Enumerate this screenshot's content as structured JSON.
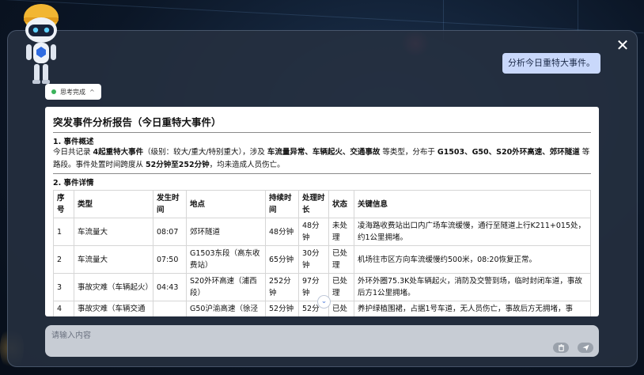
{
  "dialog": {
    "close_label": "✕"
  },
  "user_message": "分析今日重特大事件。",
  "thinking": {
    "label": "思考完成",
    "chevron": "^"
  },
  "report": {
    "title": "突发事件分析报告（今日重特大事件）",
    "section1": "1. 事件概述",
    "overview": [
      {
        "text": "今日共记录 ",
        "bold": false
      },
      {
        "text": "4起重特大事件",
        "bold": true
      },
      {
        "text": "（级别：较大/重大/特别重大），涉及 ",
        "bold": false
      },
      {
        "text": "车流量异常、车辆起火、交通事故",
        "bold": true
      },
      {
        "text": " 等类型，分布于 ",
        "bold": false
      },
      {
        "text": "G1503、G50、S20外环高速、郊环隧道",
        "bold": true
      },
      {
        "text": " 等路段。事件处置时间跨度从 ",
        "bold": false
      },
      {
        "text": "52分钟至252分钟",
        "bold": true
      },
      {
        "text": "，均未造成人员伤亡。",
        "bold": false
      }
    ],
    "section2": "2. 事件详情",
    "columns": [
      "序号",
      "类型",
      "发生时间",
      "地点",
      "持续时间",
      "处理时长",
      "状态",
      "关键信息"
    ],
    "rows": [
      [
        "1",
        "车流量大",
        "08:07",
        "郊环隧道",
        "48分钟",
        "48分钟",
        "未处理",
        "凌海路收费站出口内广场车流缓慢，通行至隧道上行K211+015处，约1公里拥堵。"
      ],
      [
        "2",
        "车流量大",
        "07:50",
        "G1503东段（高东收费站）",
        "65分钟",
        "30分钟",
        "已处理",
        "机场往市区方向车流缓慢约500米，08:20恢复正常。"
      ],
      [
        "3",
        "事故灾难（车辆起火）",
        "04:43",
        "S20外环高速（浦西段）",
        "252分钟",
        "97分钟",
        "已处理",
        "外环外圈75.3K处车辆起火，消防及交警到场，临时封闭车道，事故后方1公里拥堵。"
      ],
      [
        "4",
        "事故灾难（车辆交通",
        "",
        "G50沪渝高速（徐泾",
        "52分钟",
        "52分",
        "已处",
        "养护绿植围裙，占据1号车道，无人员伤亡，事故后方无拥堵，事"
      ]
    ]
  },
  "scroll_hint": "⌄",
  "input": {
    "placeholder": "请输入内容",
    "value": ""
  },
  "buttons": {
    "clear_icon": "trash-icon",
    "send_icon": "send-icon"
  },
  "colors": {
    "panel": "#263040",
    "bubble": "#c9d8fb",
    "status_green": "#3bb35b"
  }
}
